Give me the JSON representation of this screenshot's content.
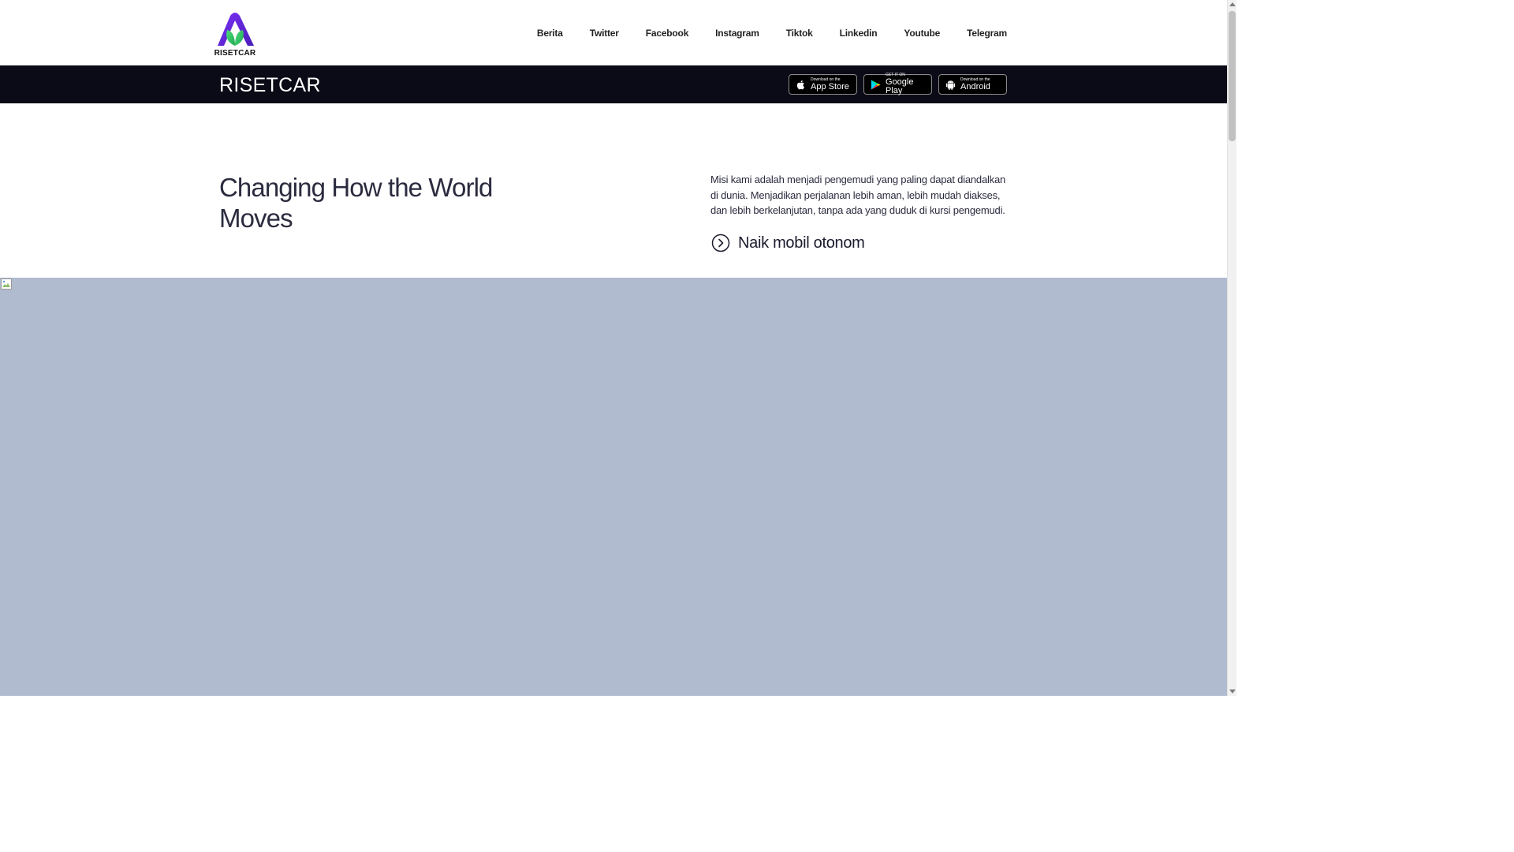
{
  "header": {
    "logo_text": "RISETCAR",
    "nav": [
      "Berita",
      "Twitter",
      "Facebook",
      "Instagram",
      "Tiktok",
      "Linkedin",
      "Youtube",
      "Telegram"
    ]
  },
  "band": {
    "title": "RISETCAR",
    "stores": {
      "apple": {
        "small": "Download on the",
        "big": "App Store"
      },
      "google": {
        "small": "GET IT ON",
        "big": "Google Play"
      },
      "android": {
        "small": "Download on the",
        "big": "Android"
      }
    }
  },
  "hero": {
    "title": "Changing How the World Moves",
    "description": "Misi kami adalah menjadi pengemudi yang paling dapat diandalkan di dunia. Menjadikan perjalanan lebih aman, lebih mudah diakses, dan lebih berkelanjutan, tanpa ada yang duduk di kursi pengemudi.",
    "cta_label": "Naik mobil otonom"
  },
  "colors": {
    "band_bg": "#0b0b17",
    "image_placeholder": "#b0bbd0",
    "logo_green": "#2fbf5b",
    "logo_purple": "#6a2bd9"
  },
  "icons": [
    "logo-icon",
    "apple-icon",
    "google-play-icon",
    "android-icon",
    "chevron-circle-right-icon",
    "broken-image-icon"
  ]
}
